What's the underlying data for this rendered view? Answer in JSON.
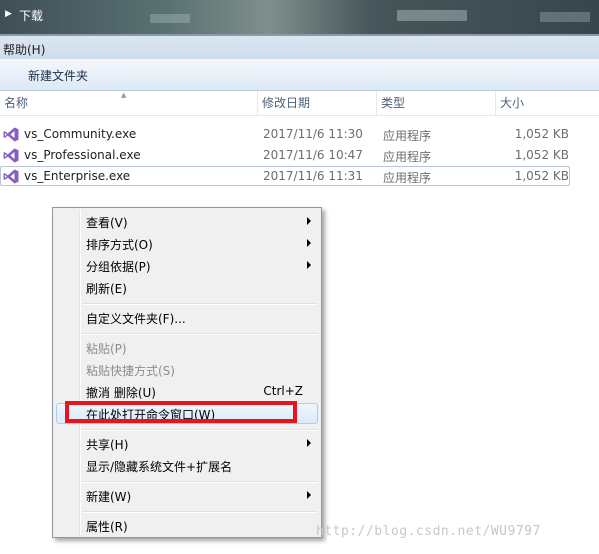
{
  "window": {
    "title": "下载"
  },
  "menubar": {
    "help": "帮助(H)"
  },
  "toolbar": {
    "new_folder": "新建文件夹"
  },
  "columns": {
    "name": "名称",
    "modified": "修改日期",
    "type": "类型",
    "size": "大小"
  },
  "files": [
    {
      "name": "vs_Community.exe",
      "modified": "2017/11/6 11:30",
      "type": "应用程序",
      "size": "1,052 KB",
      "icon": "visual-studio-icon"
    },
    {
      "name": "vs_Professional.exe",
      "modified": "2017/11/6 10:47",
      "type": "应用程序",
      "size": "1,052 KB",
      "icon": "visual-studio-icon"
    },
    {
      "name": "vs_Enterprise.exe",
      "modified": "2017/11/6 11:31",
      "type": "应用程序",
      "size": "1,052 KB",
      "icon": "visual-studio-icon",
      "selected": true
    }
  ],
  "context_menu": {
    "view": "查看(V)",
    "sort_by": "排序方式(O)",
    "group_by": "分组依据(P)",
    "refresh": "刷新(E)",
    "customize": "自定义文件夹(F)...",
    "paste": "粘贴(P)",
    "paste_shortcut": "粘贴快捷方式(S)",
    "undo_delete": "撤消 删除(U)",
    "undo_shortcut": "Ctrl+Z",
    "open_cmd_here": "在此处打开命令窗口(W)",
    "share": "共享(H)",
    "show_hide": "显示/隐藏系统文件+扩展名",
    "new": "新建(W)",
    "properties": "属性(R)"
  },
  "watermark": "http://blog.csdn.net/WU9797",
  "colors": {
    "highlight_box": "#e3171b",
    "vs_purple": "#865fc5"
  }
}
